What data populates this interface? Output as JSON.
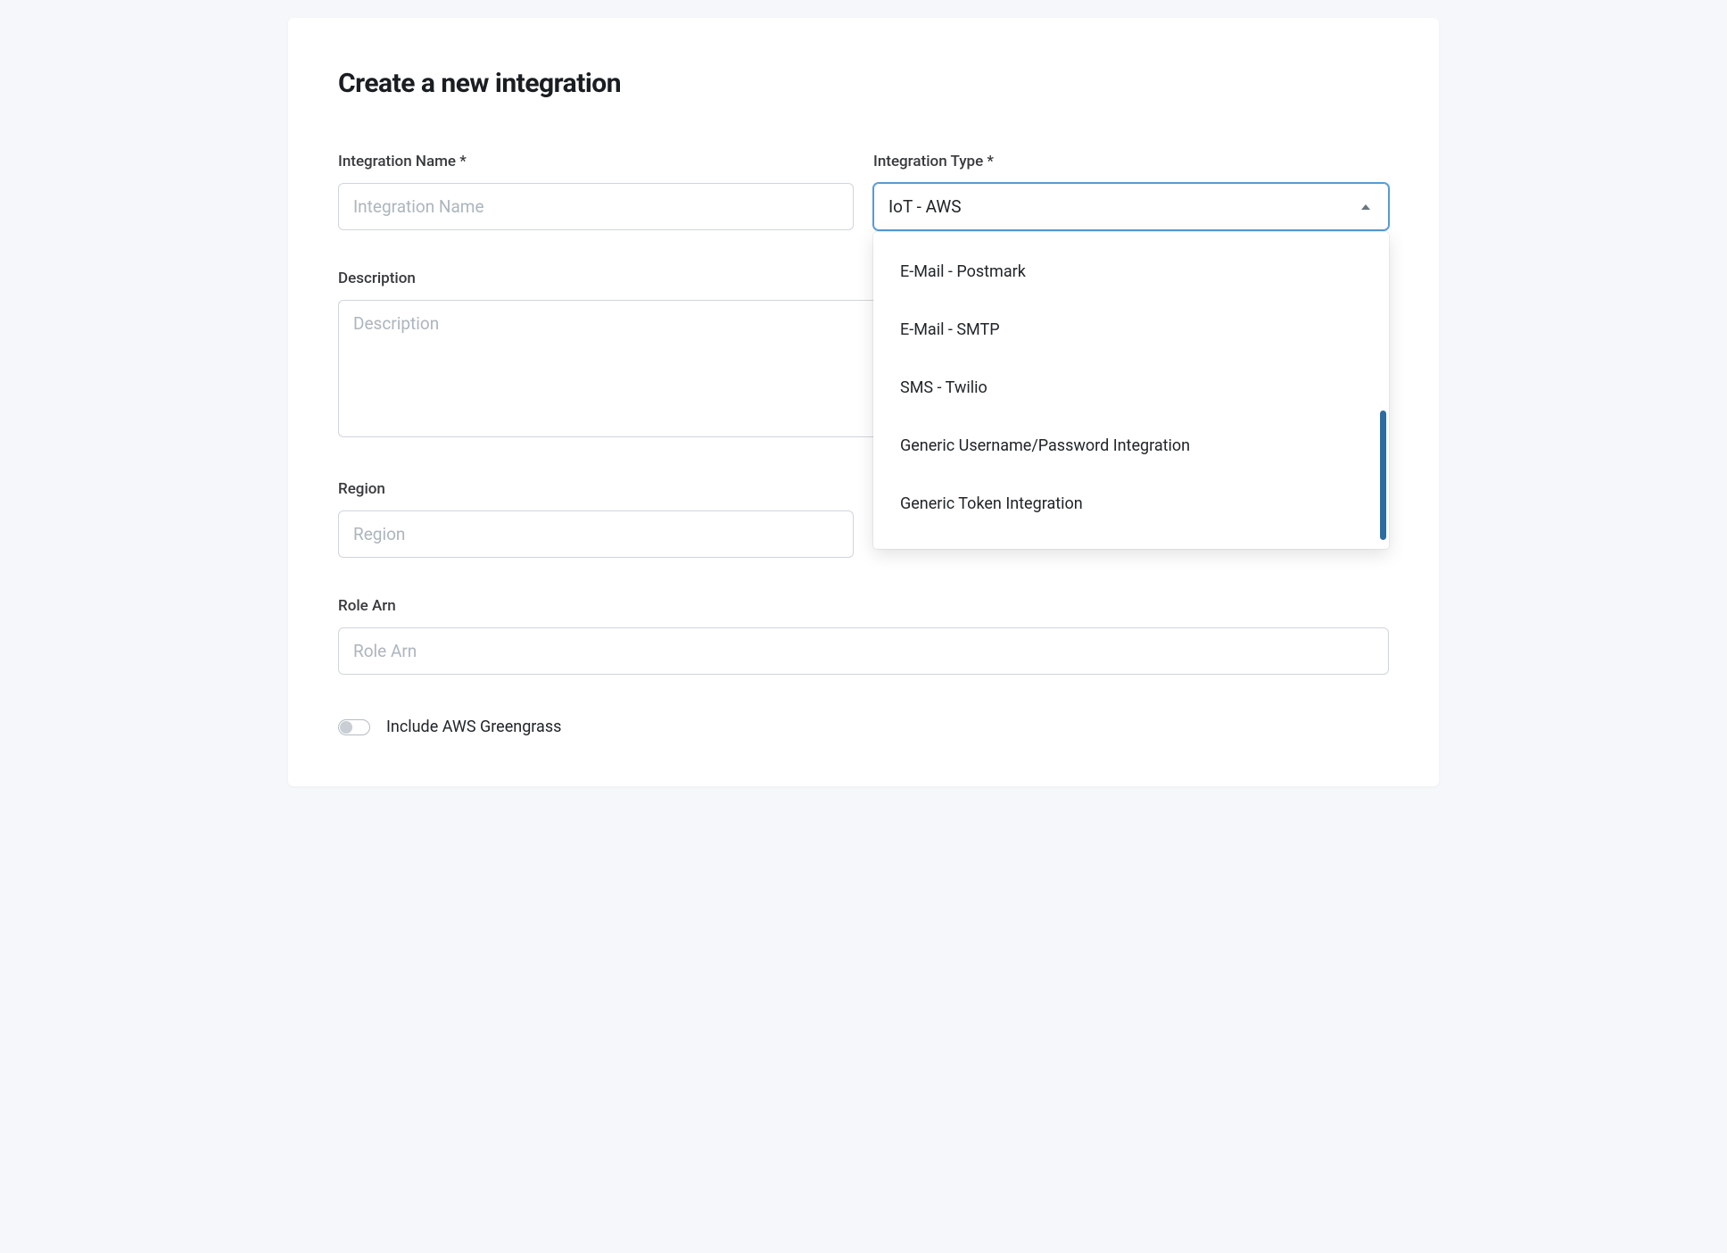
{
  "page": {
    "title": "Create a new integration"
  },
  "fields": {
    "integrationName": {
      "label": "Integration Name *",
      "placeholder": "Integration Name",
      "value": ""
    },
    "integrationType": {
      "label": "Integration Type *",
      "selected": "IoT - AWS",
      "options": [
        "E-Mail - Postmark",
        "E-Mail - SMTP",
        "SMS - Twilio",
        "Generic Username/Password Integration",
        "Generic Token Integration"
      ]
    },
    "description": {
      "label": "Description",
      "placeholder": "Description",
      "value": ""
    },
    "region": {
      "label": "Region",
      "placeholder": "Region",
      "value": ""
    },
    "roleArn": {
      "label": "Role Arn",
      "placeholder": "Role Arn",
      "value": ""
    },
    "greengrass": {
      "label": "Include AWS Greengrass"
    }
  }
}
